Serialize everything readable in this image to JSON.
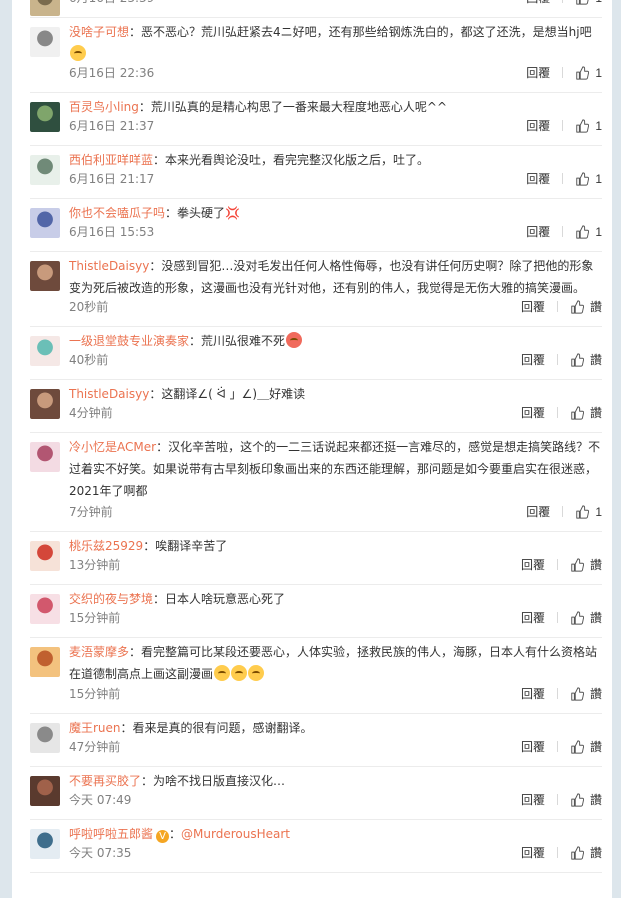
{
  "reply_label": "回覆",
  "comments": [
    {
      "user": "",
      "text": "",
      "time": "6月16日 23:39",
      "likes": "1"
    },
    {
      "user": "没啥子可想",
      "text": "恶不恶心？荒川弘赶紧去4ニ好吧，还有那些给钢炼洗白的，都这了还洗，是想当hj吧",
      "time": "6月16日 22:36",
      "likes": "1",
      "emoji": true
    },
    {
      "user": "百灵鸟小ling",
      "text": "荒川弘真的是精心构思了一番来最大程度地恶心人呢^^",
      "time": "6月16日 21:37",
      "likes": "1"
    },
    {
      "user": "西伯利亚咩咩蓝",
      "text": "本来光看舆论没吐，看完完整汉化版之后，吐了。",
      "time": "6月16日 21:17",
      "likes": "1"
    },
    {
      "user": "你也不会嗑瓜子吗",
      "text": "拳头硬了💢",
      "time": "6月16日 15:53",
      "likes": "1"
    },
    {
      "user": "ThistleDaisyy",
      "text": "没感到冒犯…没对毛发出任何人格性侮辱，也没有讲任何历史啊？除了把他的形象变为死后被改造的形象，这漫画也没有光针对他，还有别的伟人，我觉得是无伤大雅的搞笑漫画。",
      "time": "20秒前",
      "likes": "讚"
    },
    {
      "user": "一级退堂鼓专业演奏家",
      "text": "荒川弘很难不死",
      "time": "40秒前",
      "likes": "讚",
      "emoji_red": true
    },
    {
      "user": "ThistleDaisyy",
      "text": "这翻译∠( ᐛ 」∠)＿好难读",
      "time": "4分钟前",
      "likes": "讚"
    },
    {
      "user": "冷小忆是ACMer",
      "text": "汉化辛苦啦，这个的一二三话说起来都还挺一言难尽的，感觉是想走搞笑路线？不过着实不好笑。如果说带有古早刻板印象画出来的东西还能理解，那问题是如今要重启实在很迷惑，2021年了啊都",
      "time": "7分钟前",
      "likes": "1"
    },
    {
      "user": "桃乐兹25929",
      "text": "唉翻译辛苦了",
      "time": "13分钟前",
      "likes": "讚"
    },
    {
      "user": "交织的夜与梦境",
      "text": "日本人啥玩意恶心死了",
      "time": "15分钟前",
      "likes": "讚"
    },
    {
      "user": "麦浯蒙摩多",
      "text": "看完整篇可比某段还要恶心，人体实验，拯救民族的伟人，海豚，日本人有什么资格站在道德制高点上画这副漫画",
      "time": "15分钟前",
      "likes": "讚",
      "emoji3": true
    },
    {
      "user": "魔王ruen",
      "text": "看来是真的很有问题，感谢翻译。",
      "time": "47分钟前",
      "likes": "讚"
    },
    {
      "user": "不要再买胶了",
      "text": "为啥不找日版直接汉化…",
      "time": "今天 07:49",
      "likes": "讚"
    },
    {
      "user": "呼啦呼啦五郎酱",
      "text": "@MurderousHeart",
      "time": "今天 07:35",
      "likes": "讚",
      "verified": true
    }
  ]
}
